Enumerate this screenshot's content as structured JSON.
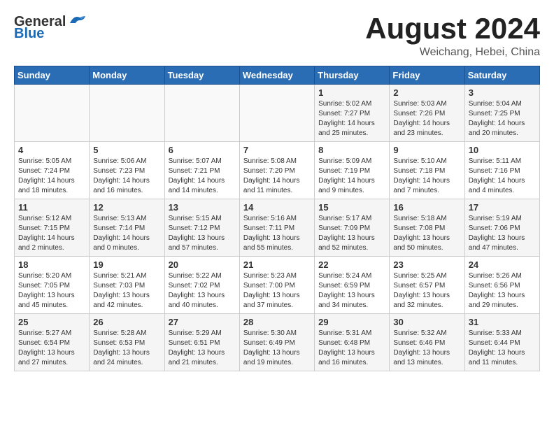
{
  "header": {
    "logo_general": "General",
    "logo_blue": "Blue",
    "month_year": "August 2024",
    "location": "Weichang, Hebei, China"
  },
  "days_of_week": [
    "Sunday",
    "Monday",
    "Tuesday",
    "Wednesday",
    "Thursday",
    "Friday",
    "Saturday"
  ],
  "weeks": [
    {
      "days": [
        {
          "number": "",
          "info": ""
        },
        {
          "number": "",
          "info": ""
        },
        {
          "number": "",
          "info": ""
        },
        {
          "number": "",
          "info": ""
        },
        {
          "number": "1",
          "info": "Sunrise: 5:02 AM\nSunset: 7:27 PM\nDaylight: 14 hours\nand 25 minutes."
        },
        {
          "number": "2",
          "info": "Sunrise: 5:03 AM\nSunset: 7:26 PM\nDaylight: 14 hours\nand 23 minutes."
        },
        {
          "number": "3",
          "info": "Sunrise: 5:04 AM\nSunset: 7:25 PM\nDaylight: 14 hours\nand 20 minutes."
        }
      ]
    },
    {
      "days": [
        {
          "number": "4",
          "info": "Sunrise: 5:05 AM\nSunset: 7:24 PM\nDaylight: 14 hours\nand 18 minutes."
        },
        {
          "number": "5",
          "info": "Sunrise: 5:06 AM\nSunset: 7:23 PM\nDaylight: 14 hours\nand 16 minutes."
        },
        {
          "number": "6",
          "info": "Sunrise: 5:07 AM\nSunset: 7:21 PM\nDaylight: 14 hours\nand 14 minutes."
        },
        {
          "number": "7",
          "info": "Sunrise: 5:08 AM\nSunset: 7:20 PM\nDaylight: 14 hours\nand 11 minutes."
        },
        {
          "number": "8",
          "info": "Sunrise: 5:09 AM\nSunset: 7:19 PM\nDaylight: 14 hours\nand 9 minutes."
        },
        {
          "number": "9",
          "info": "Sunrise: 5:10 AM\nSunset: 7:18 PM\nDaylight: 14 hours\nand 7 minutes."
        },
        {
          "number": "10",
          "info": "Sunrise: 5:11 AM\nSunset: 7:16 PM\nDaylight: 14 hours\nand 4 minutes."
        }
      ]
    },
    {
      "days": [
        {
          "number": "11",
          "info": "Sunrise: 5:12 AM\nSunset: 7:15 PM\nDaylight: 14 hours\nand 2 minutes."
        },
        {
          "number": "12",
          "info": "Sunrise: 5:13 AM\nSunset: 7:14 PM\nDaylight: 14 hours\nand 0 minutes."
        },
        {
          "number": "13",
          "info": "Sunrise: 5:15 AM\nSunset: 7:12 PM\nDaylight: 13 hours\nand 57 minutes."
        },
        {
          "number": "14",
          "info": "Sunrise: 5:16 AM\nSunset: 7:11 PM\nDaylight: 13 hours\nand 55 minutes."
        },
        {
          "number": "15",
          "info": "Sunrise: 5:17 AM\nSunset: 7:09 PM\nDaylight: 13 hours\nand 52 minutes."
        },
        {
          "number": "16",
          "info": "Sunrise: 5:18 AM\nSunset: 7:08 PM\nDaylight: 13 hours\nand 50 minutes."
        },
        {
          "number": "17",
          "info": "Sunrise: 5:19 AM\nSunset: 7:06 PM\nDaylight: 13 hours\nand 47 minutes."
        }
      ]
    },
    {
      "days": [
        {
          "number": "18",
          "info": "Sunrise: 5:20 AM\nSunset: 7:05 PM\nDaylight: 13 hours\nand 45 minutes."
        },
        {
          "number": "19",
          "info": "Sunrise: 5:21 AM\nSunset: 7:03 PM\nDaylight: 13 hours\nand 42 minutes."
        },
        {
          "number": "20",
          "info": "Sunrise: 5:22 AM\nSunset: 7:02 PM\nDaylight: 13 hours\nand 40 minutes."
        },
        {
          "number": "21",
          "info": "Sunrise: 5:23 AM\nSunset: 7:00 PM\nDaylight: 13 hours\nand 37 minutes."
        },
        {
          "number": "22",
          "info": "Sunrise: 5:24 AM\nSunset: 6:59 PM\nDaylight: 13 hours\nand 34 minutes."
        },
        {
          "number": "23",
          "info": "Sunrise: 5:25 AM\nSunset: 6:57 PM\nDaylight: 13 hours\nand 32 minutes."
        },
        {
          "number": "24",
          "info": "Sunrise: 5:26 AM\nSunset: 6:56 PM\nDaylight: 13 hours\nand 29 minutes."
        }
      ]
    },
    {
      "days": [
        {
          "number": "25",
          "info": "Sunrise: 5:27 AM\nSunset: 6:54 PM\nDaylight: 13 hours\nand 27 minutes."
        },
        {
          "number": "26",
          "info": "Sunrise: 5:28 AM\nSunset: 6:53 PM\nDaylight: 13 hours\nand 24 minutes."
        },
        {
          "number": "27",
          "info": "Sunrise: 5:29 AM\nSunset: 6:51 PM\nDaylight: 13 hours\nand 21 minutes."
        },
        {
          "number": "28",
          "info": "Sunrise: 5:30 AM\nSunset: 6:49 PM\nDaylight: 13 hours\nand 19 minutes."
        },
        {
          "number": "29",
          "info": "Sunrise: 5:31 AM\nSunset: 6:48 PM\nDaylight: 13 hours\nand 16 minutes."
        },
        {
          "number": "30",
          "info": "Sunrise: 5:32 AM\nSunset: 6:46 PM\nDaylight: 13 hours\nand 13 minutes."
        },
        {
          "number": "31",
          "info": "Sunrise: 5:33 AM\nSunset: 6:44 PM\nDaylight: 13 hours\nand 11 minutes."
        }
      ]
    }
  ]
}
